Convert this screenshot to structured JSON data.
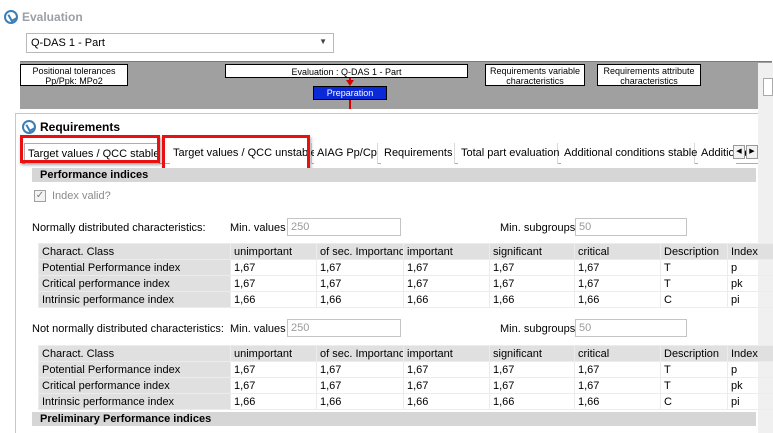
{
  "evaluation": {
    "title": "Evaluation",
    "selected": "Q-DAS 1 - Part",
    "diagram": {
      "positional": "Positional tolerances",
      "positional_sub": "Pp/Ppk: MPo2",
      "center": "Evaluation : Q-DAS 1 - Part",
      "req_variable": "Requirements variable characteristics",
      "req_attribute": "Requirements attribute characteristics",
      "preparation": "Preparation"
    }
  },
  "requirements": {
    "title": "Requirements",
    "tabs": [
      "Target values / QCC stable",
      "Target values / QCC unstable",
      "AIAG Pp/Cp",
      "Requirements",
      "Total part evaluation",
      "Additional conditions stable",
      "Additional"
    ],
    "section_performance": "Performance indices",
    "index_valid": "Index valid?",
    "normal": {
      "label": "Normally distributed characteristics:",
      "min_values_label": "Min. values",
      "min_values": "250",
      "min_subgroups_label": "Min. subgroups",
      "min_subgroups": "50"
    },
    "not_normal": {
      "label": "Not normally distributed characteristics:",
      "min_values_label": "Min. values",
      "min_values": "250",
      "min_subgroups_label": "Min. subgroups",
      "min_subgroups": "50"
    },
    "columns": [
      "Charact. Class",
      "unimportant",
      "of sec. Importance",
      "important",
      "significant",
      "critical",
      "Description",
      "Index"
    ],
    "table_normal": [
      [
        "Potential Performance index",
        "1,67",
        "1,67",
        "1,67",
        "1,67",
        "1,67",
        "T",
        "p"
      ],
      [
        "Critical  performance index",
        "1,67",
        "1,67",
        "1,67",
        "1,67",
        "1,67",
        "T",
        "pk"
      ],
      [
        "Intrinsic performance index",
        "1,66",
        "1,66",
        "1,66",
        "1,66",
        "1,66",
        "C",
        "pi"
      ]
    ],
    "table_not_normal": [
      [
        "Potential Performance index",
        "1,67",
        "1,67",
        "1,67",
        "1,67",
        "1,67",
        "T",
        "p"
      ],
      [
        "Critical  performance index",
        "1,67",
        "1,67",
        "1,67",
        "1,67",
        "1,67",
        "T",
        "pk"
      ],
      [
        "Intrinsic performance index",
        "1,66",
        "1,66",
        "1,66",
        "1,66",
        "1,66",
        "C",
        "pi"
      ]
    ],
    "section_preliminary": "Preliminary Performance indices"
  },
  "colors": {
    "highlight": "#e81010",
    "preparation_box": "#0a2ad8",
    "connector": "#d40000"
  }
}
